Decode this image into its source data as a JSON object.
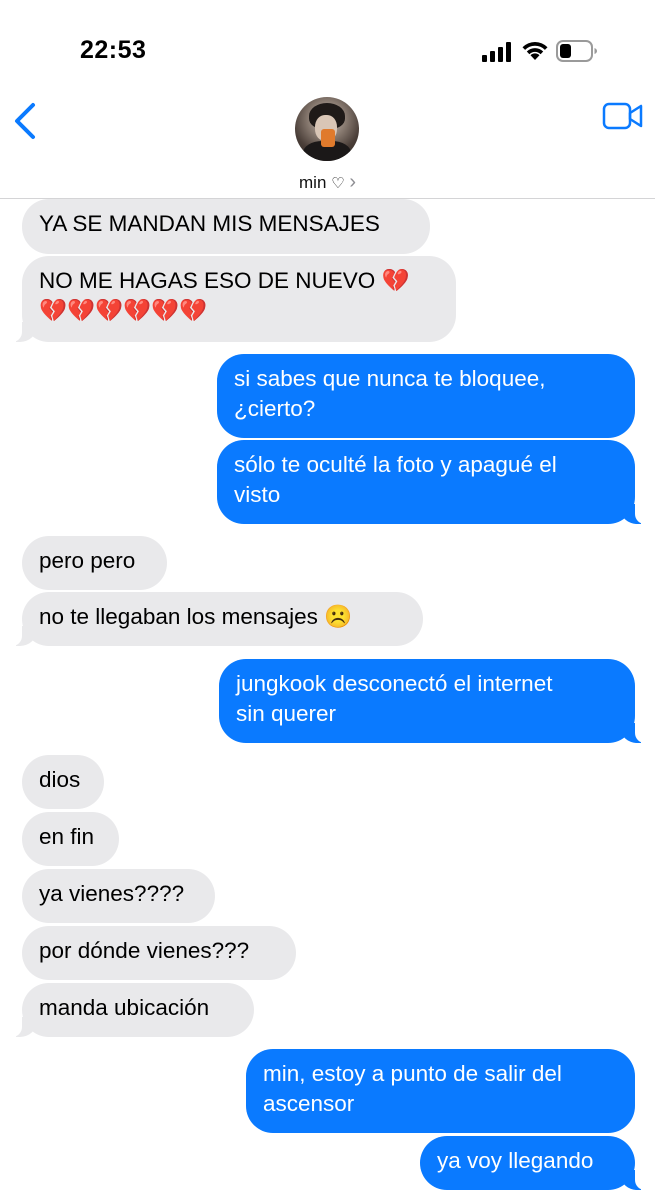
{
  "status_bar": {
    "time": "22:53"
  },
  "header": {
    "contact_name": "min",
    "heart": "♡",
    "chevron": "›"
  },
  "messages": [
    {
      "from": "contact",
      "text": "YA SE MANDAN MIS MENSAJES"
    },
    {
      "from": "contact",
      "text": "NO ME HAGAS ESO DE NUEVO 💔",
      "text2": "💔💔💔💔💔💔"
    },
    {
      "from": "me",
      "text": "si sabes que nunca te bloquee,",
      "text2": "¿cierto?"
    },
    {
      "from": "me",
      "text": "sólo te oculté la foto y apagué el",
      "text2": "visto"
    },
    {
      "from": "contact",
      "text": "pero pero"
    },
    {
      "from": "contact",
      "text": "no te llegaban los mensajes ☹️"
    },
    {
      "from": "me",
      "text": "jungkook desconectó el internet",
      "text2": "sin querer"
    },
    {
      "from": "contact",
      "text": "dios"
    },
    {
      "from": "contact",
      "text": "en fin"
    },
    {
      "from": "contact",
      "text": "ya vienes????"
    },
    {
      "from": "contact",
      "text": "por dónde vienes???"
    },
    {
      "from": "contact",
      "text": "manda ubicación"
    },
    {
      "from": "me",
      "text": "min, estoy a punto de salir del",
      "text2": "ascensor"
    },
    {
      "from": "me",
      "text": "ya voy llegando"
    }
  ],
  "colors": {
    "outgoing": "#0a7aff",
    "incoming": "#e9e9eb",
    "accent": "#0a7aff"
  },
  "icons": [
    "signal-icon",
    "wifi-icon",
    "battery-icon",
    "back-chevron-icon",
    "video-call-icon",
    "heart-icon"
  ]
}
